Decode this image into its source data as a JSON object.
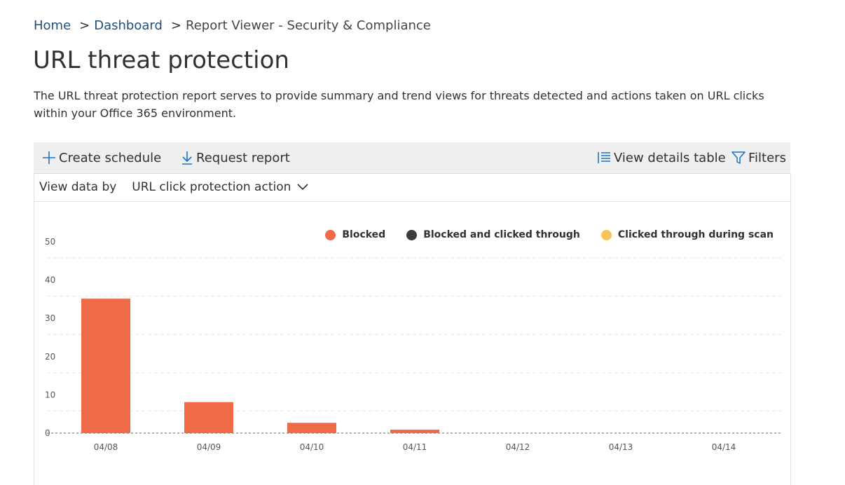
{
  "breadcrumb": {
    "home": "Home",
    "dashboard": "Dashboard",
    "current": "Report Viewer - Security & Compliance",
    "sep": ">"
  },
  "page": {
    "title": "URL threat protection",
    "description": "The URL threat protection report serves to provide summary and trend views for threats detected and actions taken on URL clicks within your Office 365 environment."
  },
  "toolbar": {
    "create_schedule": "Create schedule",
    "request_report": "Request report",
    "view_details_table": "View details table",
    "filters": "Filters",
    "icons": [
      "plus-icon",
      "download-icon",
      "list-icon",
      "filter-icon"
    ]
  },
  "view_by": {
    "label": "View data by",
    "selected": "URL click protection action"
  },
  "colors": {
    "accent": "#1a73c9",
    "blocked": "#f06a48",
    "blocked_clicked": "#3b3b3b",
    "clicked_scan": "#f7c45a"
  },
  "chart_data": {
    "type": "bar",
    "categories": [
      "04/08",
      "04/09",
      "04/10",
      "04/11",
      "04/12",
      "04/13",
      "04/14"
    ],
    "series": [
      {
        "name": "Blocked",
        "color": "#f06a48",
        "values": [
          39,
          9,
          3,
          1,
          0,
          0,
          0
        ]
      },
      {
        "name": "Blocked and clicked through",
        "color": "#3b3b3b",
        "values": [
          0,
          0,
          0,
          0,
          0,
          0,
          0
        ]
      },
      {
        "name": "Clicked through during scan",
        "color": "#f7c45a",
        "values": [
          0,
          0,
          0,
          0,
          0,
          0,
          0
        ]
      }
    ],
    "yticks": [
      "50",
      "40",
      "30",
      "20",
      "10",
      "0"
    ],
    "ylim": [
      0,
      50
    ],
    "grid": true,
    "legend_position": "top-right"
  }
}
